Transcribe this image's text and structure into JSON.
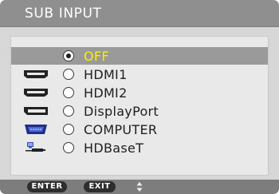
{
  "menu": {
    "title": "SUB INPUT",
    "selected_index": 0,
    "items": [
      {
        "label": "OFF",
        "icon": "none",
        "selected": true
      },
      {
        "label": "HDMI1",
        "icon": "hdmi-icon",
        "selected": false
      },
      {
        "label": "HDMI2",
        "icon": "hdmi-icon",
        "selected": false
      },
      {
        "label": "DisplayPort",
        "icon": "displayport-icon",
        "selected": false
      },
      {
        "label": "COMPUTER",
        "icon": "vga-computer-icon",
        "selected": false
      },
      {
        "label": "HDBaseT",
        "icon": "hdbaset-network-icon",
        "selected": false
      }
    ]
  },
  "footer": {
    "enter_label": "ENTER",
    "exit_label": "EXIT",
    "navigation_icon": "up-down-arrows-icon"
  },
  "colors": {
    "selected_text": "#ffee00",
    "selected_row": "#9a9a9a",
    "title_bar": "#8f8f8f",
    "panel_background": "#d7d7d7"
  }
}
